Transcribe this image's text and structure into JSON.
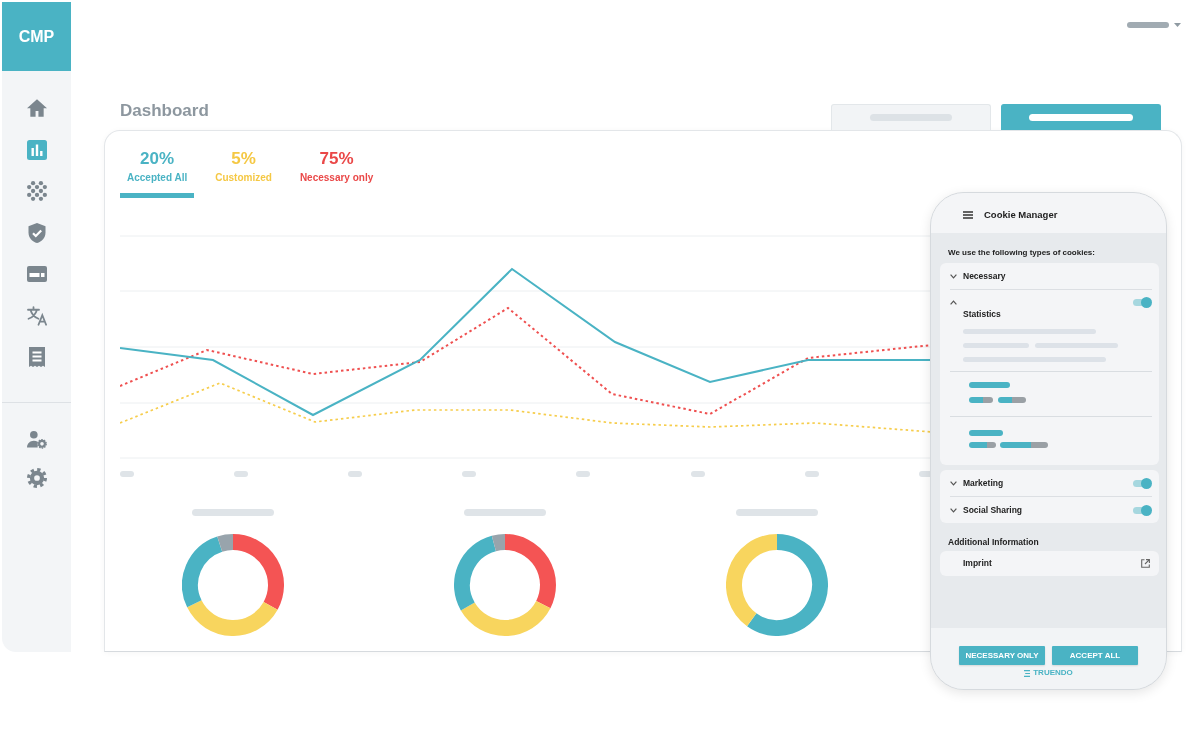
{
  "sidebar": {
    "logo": "CMP",
    "items": [
      {
        "selected": false
      },
      {
        "selected": true
      },
      {
        "selected": false
      },
      {
        "selected": false
      },
      {
        "selected": false
      },
      {
        "selected": false
      },
      {
        "selected": false
      }
    ],
    "bottom_items": [
      {
        "selected": false
      },
      {
        "selected": false
      }
    ]
  },
  "page_title": "Dashboard",
  "view_tabs": [
    {
      "selected": false
    },
    {
      "selected": true
    }
  ],
  "stats": [
    {
      "value": "20%",
      "label": "Accepted All",
      "color": "#4ab3c4",
      "selected": true
    },
    {
      "value": "5%",
      "label": "Customized",
      "color": "#f5c844",
      "selected": false
    },
    {
      "value": "75%",
      "label": "Necessary only",
      "color": "#ea4848",
      "selected": false
    }
  ],
  "cookie_manager": {
    "title": "Cookie Manager",
    "intro": "We use the following types of cookies:",
    "groups": [
      {
        "categories": [
          {
            "kind": "required",
            "label": "Necessary",
            "expanded": false
          },
          {
            "kind": "optional",
            "label": "Statistics",
            "expanded": true,
            "on": true
          }
        ]
      },
      {
        "categories": [
          {
            "kind": "optional",
            "label": "Marketing",
            "expanded": false,
            "on": true
          },
          {
            "kind": "optional",
            "label": "Social Sharing",
            "expanded": false,
            "on": true
          }
        ]
      }
    ],
    "info_heading": "Additional Information",
    "links": [
      {
        "label": "Imprint"
      }
    ],
    "buttons": [
      "NECESSARY ONLY",
      "ACCEPT ALL"
    ],
    "brand": "TRUENDO"
  }
}
